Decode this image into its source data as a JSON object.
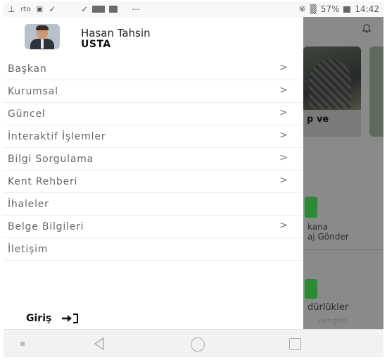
{
  "status_bar": {
    "left_icons": [
      "notification-icon",
      "app-icon",
      "tile-icon",
      "twitter-icon"
    ],
    "right_text": "✳ ▕ 57%",
    "battery": "57%",
    "time": "14:42"
  },
  "drawer": {
    "profile": {
      "first_name": "Hasan Tahsin",
      "last_name": "USTA"
    },
    "menu_items": [
      {
        "label": "Başkan",
        "has_chevron": true
      },
      {
        "label": "Kurumsal",
        "has_chevron": true
      },
      {
        "label": "Güncel",
        "has_chevron": true
      },
      {
        "label": "İnteraktif İşlemler",
        "has_chevron": true
      },
      {
        "label": "Bilgi Sorgulama",
        "has_chevron": true
      },
      {
        "label": "Kent Rehberi",
        "has_chevron": true
      },
      {
        "label": "İhaleler",
        "has_chevron": false
      },
      {
        "label": "Belge Bilgileri",
        "has_chevron": true
      },
      {
        "label": "İletişim",
        "has_chevron": false
      }
    ],
    "chevron": ">",
    "login_label": "Giriş"
  },
  "background_app": {
    "card_caption": "p ve",
    "tile1_line1": "kana",
    "tile1_line2": "aj Gönder",
    "tile2_label": "dürlükler",
    "tile2_sub": "iletişim"
  },
  "colors": {
    "overlay": "#8a8a8a",
    "accent_green": "#2c8a35",
    "menu_text": "#666666"
  }
}
